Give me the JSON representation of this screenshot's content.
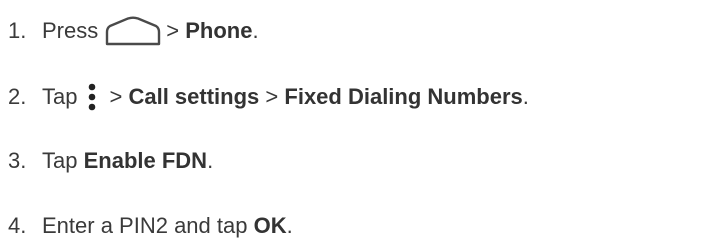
{
  "steps": [
    {
      "number": "1.",
      "parts": {
        "verb": "Press",
        "sep": ">",
        "target": "Phone",
        "end": "."
      },
      "icon": "home-key-icon"
    },
    {
      "number": "2.",
      "parts": {
        "verb": "Tap",
        "sep1": ">",
        "item1": "Call settings",
        "sep2": ">",
        "item2": "Fixed Dialing Numbers",
        "end": "."
      },
      "icon": "menu-more-icon"
    },
    {
      "number": "3.",
      "parts": {
        "verb": "Tap",
        "target": "Enable FDN",
        "end": "."
      }
    },
    {
      "number": "4.",
      "parts": {
        "text": "Enter a PIN2 and tap",
        "target": "OK",
        "end": "."
      }
    }
  ],
  "colors": {
    "text": "#3a3a3a",
    "icon_stroke": "#4a4a4a",
    "background": "#ffffff"
  }
}
